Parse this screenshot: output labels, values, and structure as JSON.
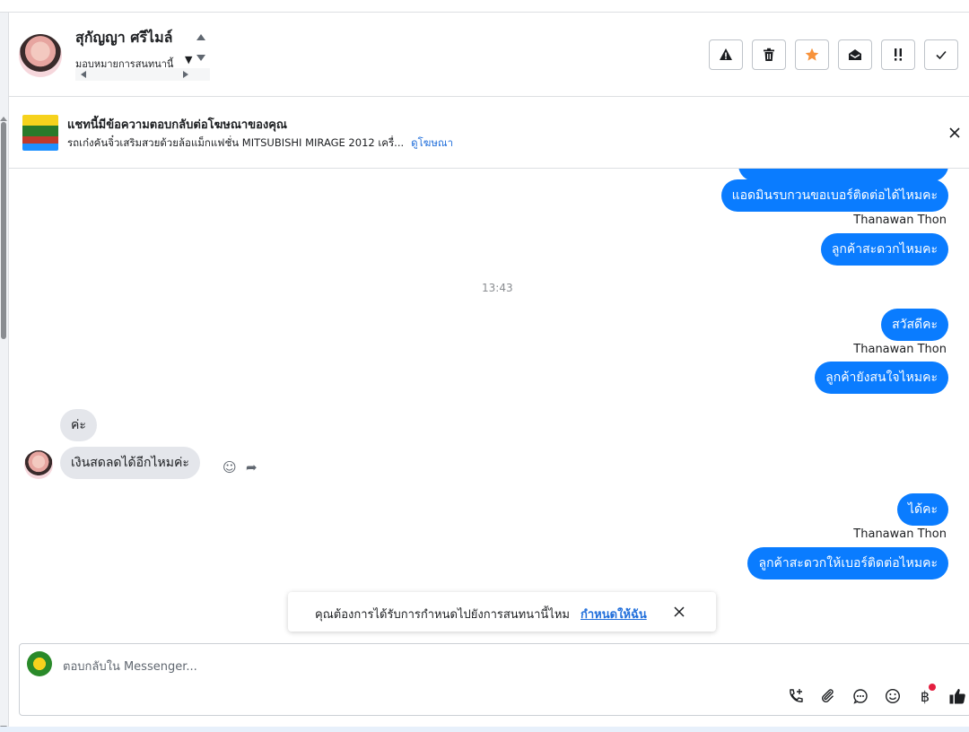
{
  "header": {
    "name": "สุกัญญา ศรีไมล์",
    "assign_label": "มอบหมายการสนทนานี้",
    "actions": [
      {
        "icon": "warning-icon",
        "label": "spam"
      },
      {
        "icon": "trash-icon",
        "label": "delete"
      },
      {
        "icon": "star-icon",
        "label": "follow-up"
      },
      {
        "icon": "envelope-open-icon",
        "label": "mark-unread"
      },
      {
        "icon": "priority-icon",
        "label": "priority"
      },
      {
        "icon": "check-icon",
        "label": "done"
      }
    ],
    "star_color": "#f7923b"
  },
  "ad_banner": {
    "title": "แชทนี้มีข้อความตอบกลับต่อโฆษณาของคุณ",
    "subtitle": "รถเก๋งคันจิ๋วเสริมสวยด้วยล้อแม็กแฟชั่น MITSUBISHI MIRAGE 2012 เครื่...",
    "link": "ดูโฆษณา"
  },
  "messages": {
    "m1": "แอดมินรบกวนขอเบอร์ติดต่อได้ไหมคะ",
    "sender1": "Thanawan Thon",
    "m2": "ลูกค้าสะดวกไหมคะ",
    "time": "13:43",
    "m3": "สวัสดีคะ",
    "sender2": "Thanawan Thon",
    "m4": "ลูกค้ายังสนใจไหมคะ",
    "in1": "ค่ะ",
    "in2": "เงินสดลดได้อีกไหมค่ะ",
    "m5": "ได้คะ",
    "sender3": "Thanawan Thon",
    "m6": "ลูกค้าสะดวกให้เบอร์ติดต่อไหมคะ"
  },
  "toast": {
    "text": "คุณต้องการได้รับการกำหนดไปยังการสนทนานี้ไหม",
    "action": "กำหนดให้ฉัน"
  },
  "composer": {
    "placeholder": "ตอบกลับใน Messenger...",
    "icons": [
      "phone-add-icon",
      "paperclip-icon",
      "saved-reply-icon",
      "emoji-icon",
      "baht-icon",
      "like-icon"
    ],
    "notification_dot_color": "#e41e3f"
  },
  "colors": {
    "outgoing_bubble": "#0a7cff",
    "incoming_bubble": "#e4e6eb",
    "link": "#216fdb"
  }
}
